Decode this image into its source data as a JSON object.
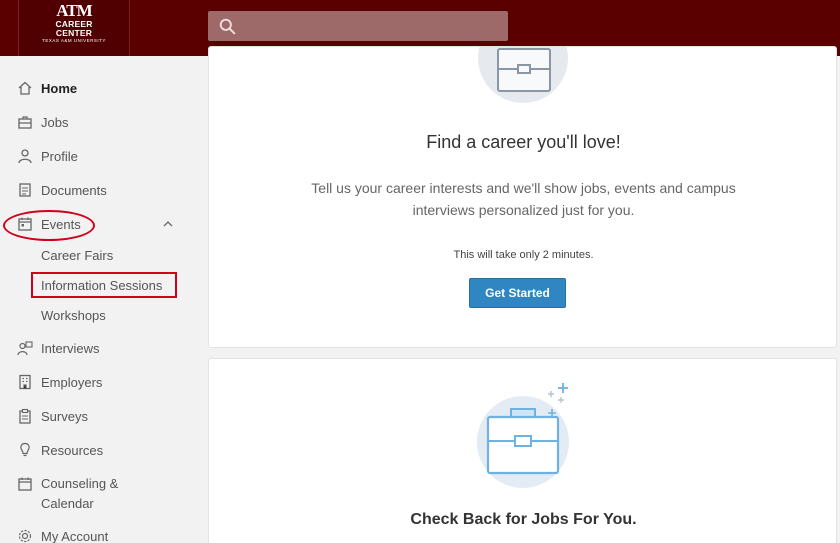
{
  "header": {
    "logo": {
      "line1": "ATM",
      "line2": "CAREER",
      "line3": "CENTER",
      "line4": "TEXAS A&M UNIVERSITY"
    },
    "search": {
      "placeholder": "",
      "icon": "search-icon"
    }
  },
  "sidebar": {
    "items": [
      {
        "label": "Home",
        "icon": "home-icon",
        "active": true
      },
      {
        "label": "Jobs",
        "icon": "briefcase-icon"
      },
      {
        "label": "Profile",
        "icon": "user-icon"
      },
      {
        "label": "Documents",
        "icon": "document-icon"
      },
      {
        "label": "Events",
        "icon": "calendar-icon",
        "expanded": true
      },
      {
        "label": "Interviews",
        "icon": "interview-icon"
      },
      {
        "label": "Employers",
        "icon": "building-icon"
      },
      {
        "label": "Surveys",
        "icon": "clipboard-icon"
      },
      {
        "label": "Resources",
        "icon": "lightbulb-icon"
      },
      {
        "label": "Counseling &",
        "label2": "Calendar",
        "icon": "calendar-icon"
      },
      {
        "label": "My Account",
        "icon": "gear-icon"
      }
    ],
    "events_sub": [
      "Career Fairs",
      "Information Sessions",
      "Workshops"
    ]
  },
  "card1": {
    "heading": "Find a career you'll love!",
    "description": "Tell us your career interests and we'll show jobs, events and campus interviews personalized just for you.",
    "note": "This will take only 2 minutes.",
    "button": "Get Started"
  },
  "card2": {
    "heading": "Check Back for Jobs For You."
  },
  "colors": {
    "header_bg": "#5b0000",
    "search_bg": "#9e6969",
    "button_bg": "#2f86c2",
    "annotation": "#d0021b"
  }
}
